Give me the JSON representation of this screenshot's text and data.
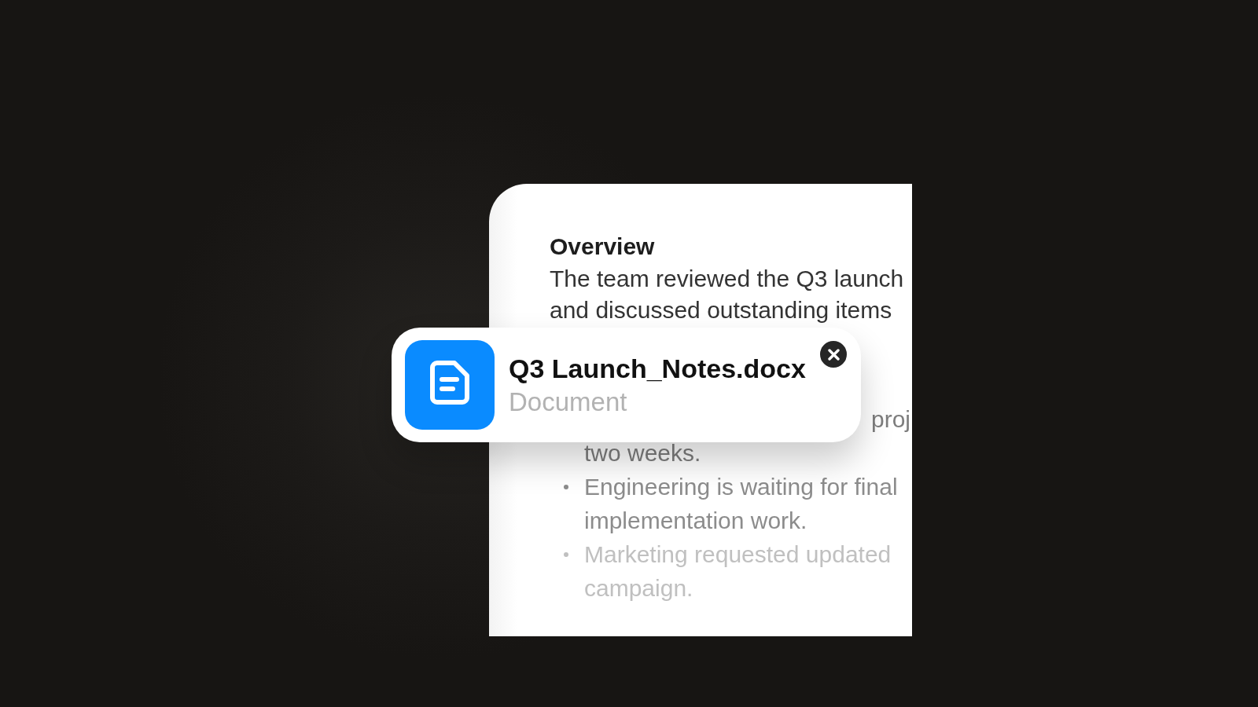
{
  "document": {
    "heading": "Overview",
    "paragraph": {
      "lines": [
        "The team reviewed the Q3 launch",
        "and discussed outstanding items"
      ]
    },
    "bullets": [
      {
        "kind": "continued",
        "lines": [
          "proj",
          "two weeks."
        ]
      },
      {
        "kind": "bullet",
        "lines": [
          "Engineering is waiting for final",
          "implementation work."
        ]
      },
      {
        "kind": "bullet",
        "lines": [
          "Marketing requested updated",
          "campaign."
        ]
      }
    ]
  },
  "attachment": {
    "file_name": "Q3 Launch_Notes.docx",
    "file_type": "Document"
  }
}
